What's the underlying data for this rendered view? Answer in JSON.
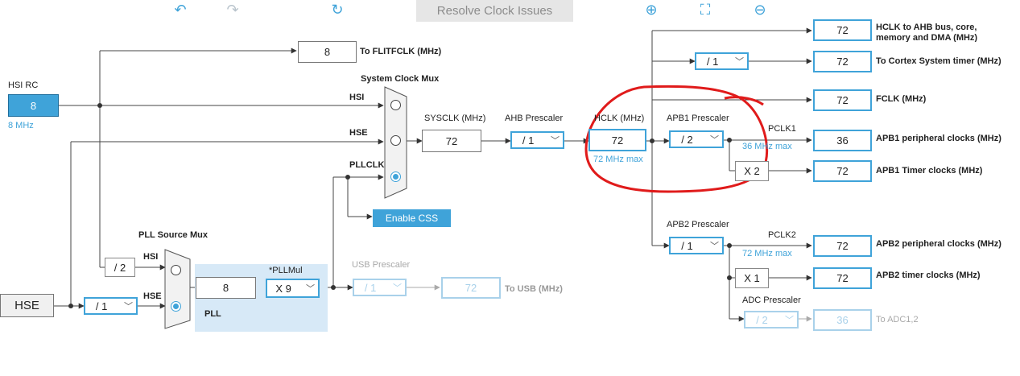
{
  "toolbar": {
    "undo_icon": "↶",
    "redo_icon": "↷",
    "refresh_icon": "↻",
    "resolve_label": "Resolve Clock Issues",
    "zoom_in_icon": "⊕",
    "fit_icon": "⛶",
    "zoom_out_icon": "⊖"
  },
  "hsi": {
    "title": "HSI RC",
    "value": "8",
    "freq": "8 MHz"
  },
  "hse": {
    "label": "HSE"
  },
  "flit": {
    "value": "8",
    "label": "To FLITFCLK (MHz)"
  },
  "sysmux": {
    "title": "System Clock Mux",
    "in_hsi": "HSI",
    "in_hse": "HSE",
    "in_pll": "PLLCLK"
  },
  "css": {
    "label": "Enable CSS"
  },
  "sysclk": {
    "label": "SYSCLK (MHz)",
    "value": "72"
  },
  "ahb": {
    "label": "AHB Prescaler",
    "value": "/ 1"
  },
  "hclk": {
    "label": "HCLK (MHz)",
    "value": "72",
    "max": "72 MHz max"
  },
  "apb1": {
    "label": "APB1 Prescaler",
    "value": "/ 2",
    "pclk": "PCLK1",
    "max": "36 MHz max",
    "x2": "X 2"
  },
  "apb2": {
    "label": "APB2 Prescaler",
    "value": "/ 1",
    "pclk": "PCLK2",
    "max": "72 MHz max",
    "x1": "X 1"
  },
  "adc": {
    "label": "ADC Prescaler",
    "value": "/ 2",
    "out": "36",
    "out_label": "To ADC1,2"
  },
  "cortex": {
    "div": "/ 1"
  },
  "outputs": [
    {
      "value": "72",
      "label": "HCLK to AHB bus, core, memory and DMA (MHz)"
    },
    {
      "value": "72",
      "label": "To Cortex System timer (MHz)"
    },
    {
      "value": "72",
      "label": "FCLK (MHz)"
    },
    {
      "value": "36",
      "label": "APB1 peripheral clocks (MHz)"
    },
    {
      "value": "72",
      "label": "APB1 Timer clocks (MHz)"
    },
    {
      "value": "72",
      "label": "APB2 peripheral clocks (MHz)"
    },
    {
      "value": "72",
      "label": "APB2 timer clocks (MHz)"
    }
  ],
  "pllsrc": {
    "title": "PLL Source Mux",
    "in_hsi": "HSI",
    "in_hse": "HSE",
    "hsi_div": "/ 2"
  },
  "pll": {
    "label": "PLL",
    "mul_label": "*PLLMul",
    "in_value": "8",
    "mul_value": "X 9"
  },
  "hse_div": {
    "value": "/ 1"
  },
  "usb": {
    "label": "USB Prescaler",
    "value": "/ 1",
    "out": "72",
    "out_label": "To USB (MHz)"
  },
  "annotation": {
    "color": "#e01b1b"
  }
}
